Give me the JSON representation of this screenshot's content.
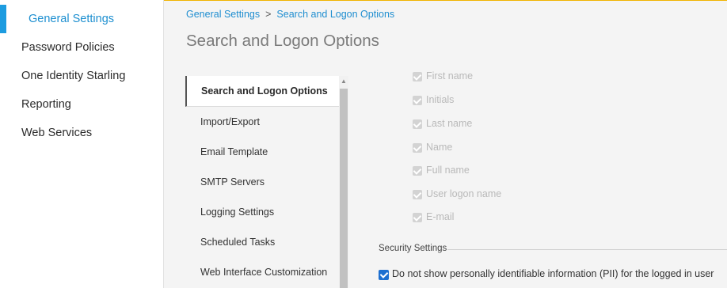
{
  "sidebar": {
    "items": [
      {
        "label": "General Settings",
        "active": true
      },
      {
        "label": "Password Policies"
      },
      {
        "label": "One Identity Starling"
      },
      {
        "label": "Reporting"
      },
      {
        "label": "Web Services"
      }
    ]
  },
  "breadcrumb": {
    "items": [
      "General Settings",
      "Search and Logon Options"
    ],
    "separator": ">"
  },
  "page_title": "Search and Logon Options",
  "subnav": {
    "items": [
      {
        "label": "Search and Logon Options",
        "active": true
      },
      {
        "label": "Import/Export"
      },
      {
        "label": "Email Template"
      },
      {
        "label": "SMTP Servers"
      },
      {
        "label": "Logging Settings"
      },
      {
        "label": "Scheduled Tasks"
      },
      {
        "label": "Web Interface Customization"
      }
    ]
  },
  "search_attributes": {
    "items": [
      {
        "label": "First name",
        "checked": true,
        "disabled": true
      },
      {
        "label": "Initials",
        "checked": true,
        "disabled": true
      },
      {
        "label": "Last name",
        "checked": true,
        "disabled": true
      },
      {
        "label": "Name",
        "checked": true,
        "disabled": true
      },
      {
        "label": "Full name",
        "checked": true,
        "disabled": true
      },
      {
        "label": "User logon name",
        "checked": true,
        "disabled": true
      },
      {
        "label": "E-mail",
        "checked": true,
        "disabled": true
      }
    ]
  },
  "security_settings": {
    "title": "Security Settings",
    "pii_label": "Do not show personally identifiable information (PII) for the logged in user",
    "pii_checked": true,
    "help_glyph": "?"
  },
  "icons": {
    "scroll_up": "scroll-up-arrow-icon",
    "help": "help-icon"
  },
  "colors": {
    "accent": "#1d9ce0",
    "link": "#1f8ed0",
    "checkbox_checked": "#1d6fd0",
    "checkbox_disabled": "#d3d3d3",
    "top_border": "#f0b400"
  }
}
